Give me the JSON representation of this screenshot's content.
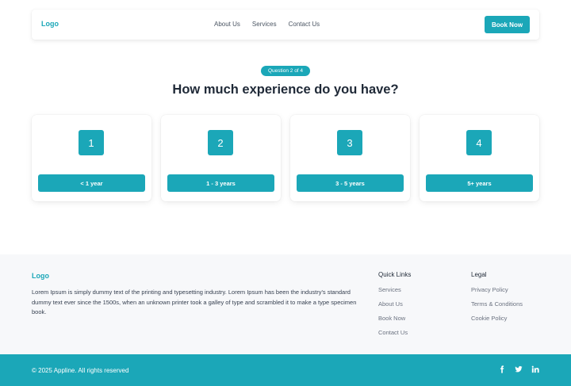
{
  "colors": {
    "accent": "#1ba7b8",
    "footer_bg": "#f7f8fa"
  },
  "nav": {
    "logo": "Logo",
    "links": [
      "About Us",
      "Services",
      "Contact Us"
    ],
    "cta": "Book Now"
  },
  "quiz": {
    "progress": "Question 2 of 4",
    "question": "How much experience do you have?",
    "options": [
      {
        "number": "1",
        "label": "< 1 year"
      },
      {
        "number": "2",
        "label": "1 - 3 years"
      },
      {
        "number": "3",
        "label": "3 - 5 years"
      },
      {
        "number": "4",
        "label": "5+ years"
      }
    ]
  },
  "footer": {
    "logo": "Logo",
    "description": "Lorem Ipsum is simply dummy text of the printing and typesetting industry. Lorem Ipsum has been the industry's standard dummy text ever since the 1500s, when an unknown printer took a galley of type and scrambled it to make a type specimen book.",
    "quick_links": {
      "title": "Quick Links",
      "items": [
        "Services",
        "About Us",
        "Book Now",
        "Contact Us"
      ]
    },
    "legal": {
      "title": "Legal",
      "items": [
        "Privacy Policy",
        "Terms & Conditions",
        "Cookie Policy"
      ]
    },
    "copyright": "© 2025 Appline. All rights reserved",
    "socials": [
      "facebook-icon",
      "twitter-icon",
      "linkedin-icon"
    ]
  }
}
